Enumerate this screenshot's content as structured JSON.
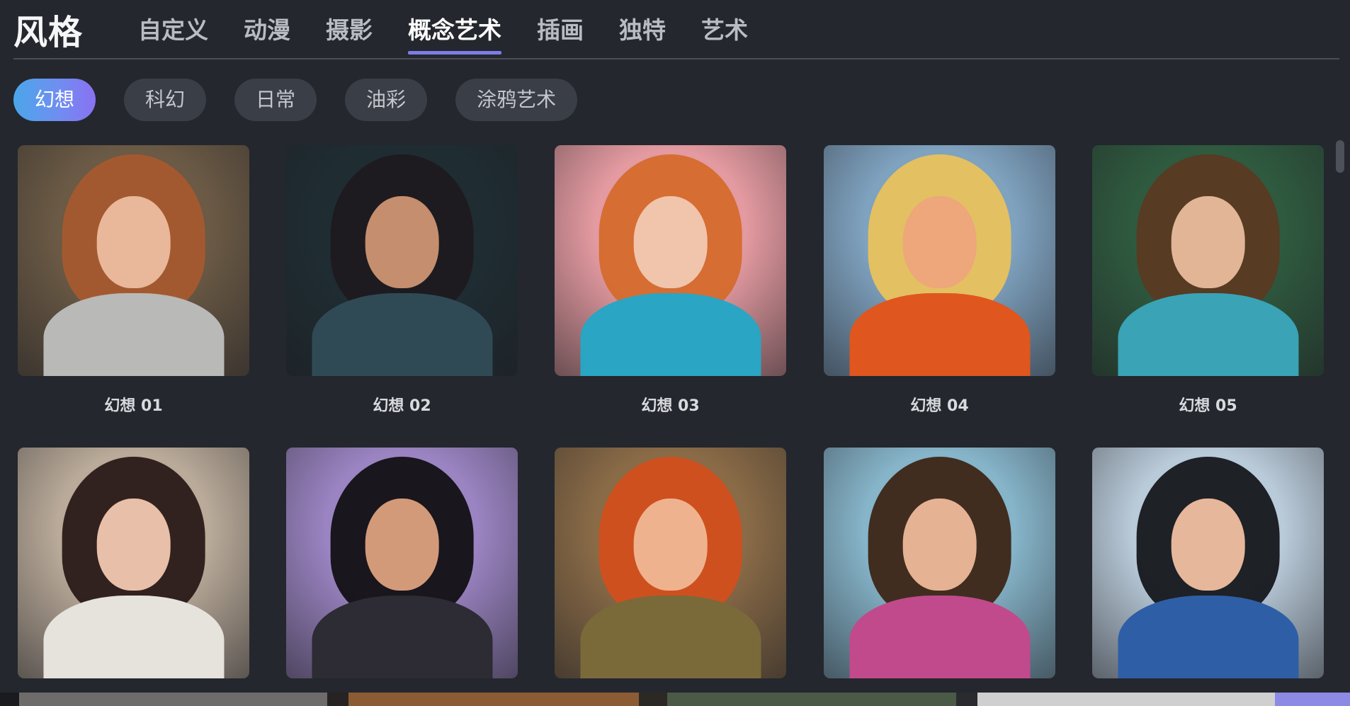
{
  "header": {
    "title": "风格",
    "tabs": [
      {
        "label": "自定义"
      },
      {
        "label": "动漫"
      },
      {
        "label": "摄影"
      },
      {
        "label": "概念艺术"
      },
      {
        "label": "插画"
      },
      {
        "label": "独特"
      },
      {
        "label": "艺术"
      }
    ],
    "active_tab": "概念艺术"
  },
  "filters": {
    "chips": [
      {
        "label": "幻想"
      },
      {
        "label": "科幻"
      },
      {
        "label": "日常"
      },
      {
        "label": "油彩"
      },
      {
        "label": "涂鸦艺术"
      }
    ],
    "active_chip": "幻想"
  },
  "gallery": {
    "items": [
      {
        "label": "幻想 01",
        "bg": "#6b5a45",
        "hair": "#a75a2e",
        "skin": "#e9b79a",
        "body": "#b9b9b7"
      },
      {
        "label": "幻想 02",
        "bg": "#1f2d33",
        "hair": "#1e1a1f",
        "skin": "#c58e6e",
        "body": "#2f4a55"
      },
      {
        "label": "幻想 03",
        "bg": "#e39aa0",
        "hair": "#d56a2d",
        "skin": "#f1c4ac",
        "body": "#2aa5c3"
      },
      {
        "label": "幻想 04",
        "bg": "#7fa2bf",
        "hair": "#e9c25c",
        "skin": "#eda77a",
        "body": "#e0561f"
      },
      {
        "label": "幻想 05",
        "bg": "#2f5a3f",
        "hair": "#5a3a22",
        "skin": "#e2b597",
        "body": "#3aa3b6"
      },
      {
        "label": "",
        "bg": "#b9aa99",
        "hair": "#2a1a18",
        "skin": "#e8bfa8",
        "body": "#e6e2dc"
      },
      {
        "label": "",
        "bg": "#9b84c2",
        "hair": "#121014",
        "skin": "#d39a79",
        "body": "#2d2b33"
      },
      {
        "label": "",
        "bg": "#8a6b47",
        "hair": "#d24f1d",
        "skin": "#efb28e",
        "body": "#7a6a3a"
      },
      {
        "label": "",
        "bg": "#86b4c9",
        "hair": "#3c2617",
        "skin": "#e5b293",
        "body": "#c14a8c"
      },
      {
        "label": "",
        "bg": "#b9cad9",
        "hair": "#15171c",
        "skin": "#e6b79a",
        "body": "#2e5fa6"
      }
    ]
  },
  "bottom_strip": {
    "colors": [
      "#1a1b1e",
      "#6d6c6b",
      "#272322",
      "#8b5c34",
      "#2c2925",
      "#4a5a46",
      "#2a2b2e",
      "#cfcfcf",
      "#8d8ae6"
    ]
  }
}
